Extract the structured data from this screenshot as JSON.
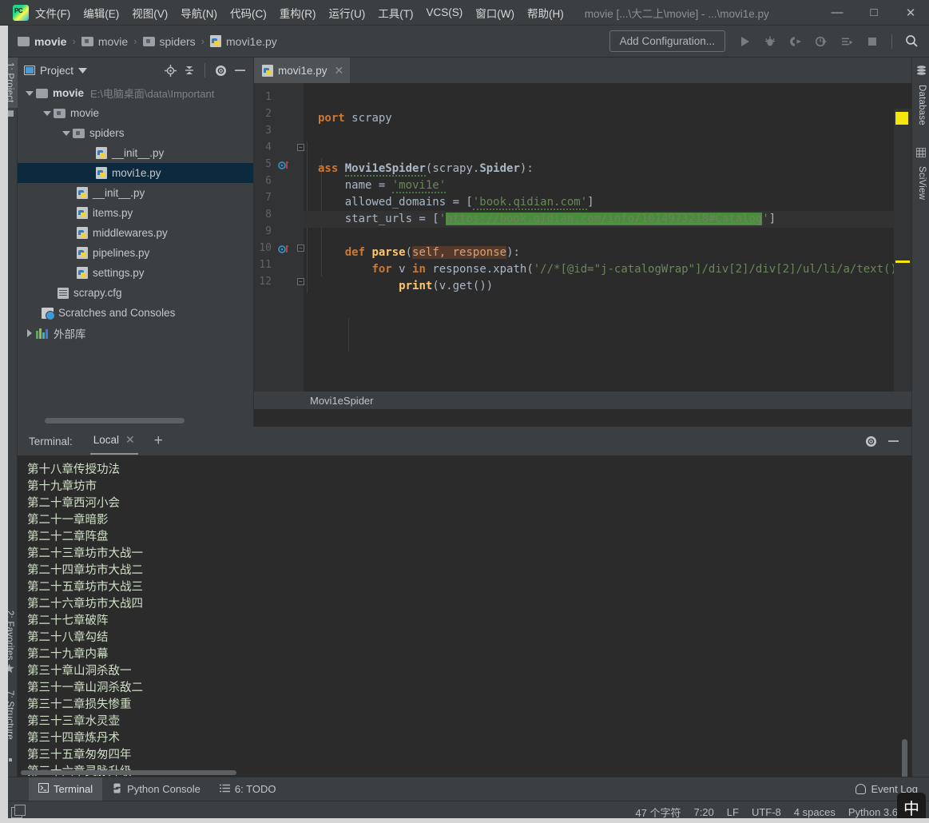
{
  "window": {
    "title": "movie [...\\大二上\\movie] - ...\\movi1e.py",
    "minimize": "—",
    "maximize": "□",
    "close": "✕"
  },
  "menubar": {
    "logo_icon": "pycharm-logo-icon",
    "items": [
      {
        "label": "文件(F)",
        "name": "menu-file"
      },
      {
        "label": "编辑(E)",
        "name": "menu-edit"
      },
      {
        "label": "视图(V)",
        "name": "menu-view"
      },
      {
        "label": "导航(N)",
        "name": "menu-navigate"
      },
      {
        "label": "代码(C)",
        "name": "menu-code"
      },
      {
        "label": "重构(R)",
        "name": "menu-refactor"
      },
      {
        "label": "运行(U)",
        "name": "menu-run"
      },
      {
        "label": "工具(T)",
        "name": "menu-tools"
      },
      {
        "label": "VCS(S)",
        "name": "menu-vcs"
      },
      {
        "label": "窗口(W)",
        "name": "menu-window"
      },
      {
        "label": "帮助(H)",
        "name": "menu-help"
      }
    ]
  },
  "toolbar": {
    "breadcrumbs": [
      {
        "label": "movie",
        "icon": "folder-icon"
      },
      {
        "label": "movie",
        "icon": "folder-icon"
      },
      {
        "label": "spiders",
        "icon": "folder-icon"
      },
      {
        "label": "movi1e.py",
        "icon": "python-file-icon"
      }
    ],
    "separator": "›",
    "add_configuration": "Add Configuration...",
    "icons": [
      "run-icon",
      "debug-icon",
      "run-coverage-icon",
      "profile-icon",
      "run-with-console-icon",
      "stop-icon",
      "search-everywhere-icon"
    ]
  },
  "left_strip": {
    "tabs": [
      {
        "label": "1: Project",
        "name": "tool-window-project",
        "active": true
      },
      {
        "label": "2: Favorites",
        "name": "tool-window-favorites",
        "active": false
      },
      {
        "label": "7: Structure",
        "name": "tool-window-structure",
        "active": false
      }
    ]
  },
  "right_strip": {
    "tabs": [
      {
        "label": "Database",
        "name": "tool-window-database"
      },
      {
        "label": "SciView",
        "name": "tool-window-sciview"
      }
    ]
  },
  "project_panel": {
    "title": "Project",
    "header_icons": [
      "locate-icon",
      "collapse-all-icon",
      "settings-gear-icon",
      "hide-icon"
    ],
    "tree": [
      {
        "label": "movie",
        "path": "E:\\电脑桌面\\data\\Important",
        "indent": 0,
        "arrow": "down",
        "icon": "folder-icon",
        "bold": true,
        "selected": false
      },
      {
        "label": "movie",
        "path": "",
        "indent": 1,
        "arrow": "down",
        "icon": "folder-inner-icon",
        "bold": false,
        "selected": false
      },
      {
        "label": "spiders",
        "path": "",
        "indent": 2,
        "arrow": "down",
        "icon": "folder-inner-icon",
        "bold": false,
        "selected": false
      },
      {
        "label": "__init__.py",
        "path": "",
        "indent": 3,
        "arrow": "none",
        "icon": "python-file-icon",
        "bold": false,
        "selected": false
      },
      {
        "label": "movi1e.py",
        "path": "",
        "indent": 3,
        "arrow": "none",
        "icon": "python-file-icon",
        "bold": false,
        "selected": true
      },
      {
        "label": "__init__.py",
        "path": "",
        "indent": 2,
        "arrow": "none",
        "icon": "python-file-icon",
        "bold": false,
        "selected": false
      },
      {
        "label": "items.py",
        "path": "",
        "indent": 2,
        "arrow": "none",
        "icon": "python-file-icon",
        "bold": false,
        "selected": false
      },
      {
        "label": "middlewares.py",
        "path": "",
        "indent": 2,
        "arrow": "none",
        "icon": "python-file-icon",
        "bold": false,
        "selected": false
      },
      {
        "label": "pipelines.py",
        "path": "",
        "indent": 2,
        "arrow": "none",
        "icon": "python-file-icon",
        "bold": false,
        "selected": false
      },
      {
        "label": "settings.py",
        "path": "",
        "indent": 2,
        "arrow": "none",
        "icon": "python-file-icon",
        "bold": false,
        "selected": false
      },
      {
        "label": "scrapy.cfg",
        "path": "",
        "indent": 1,
        "arrow": "none",
        "icon": "config-file-icon",
        "bold": false,
        "selected": false
      },
      {
        "label": "Scratches and Consoles",
        "path": "",
        "indent": 1,
        "arrow": "none",
        "icon": "scratches-icon",
        "bold": false,
        "selected": false
      },
      {
        "label": "外部库",
        "path": "",
        "indent": 0,
        "arrow": "right",
        "icon": "external-libraries-icon",
        "bold": false,
        "selected": false
      }
    ]
  },
  "editor": {
    "tab": {
      "label": "movi1e.py",
      "icon": "python-file-icon",
      "close": "✕"
    },
    "breadcrumb": "Movi1eSpider",
    "line_numbers": [
      "1",
      "2",
      "3",
      "4",
      "5",
      "6",
      "7",
      "8",
      "9",
      "10",
      "11",
      "12"
    ],
    "lines": [
      {
        "n": 1,
        "text": "port scrapy"
      },
      {
        "n": 2,
        "text": ""
      },
      {
        "n": 3,
        "text": ""
      },
      {
        "n": 4,
        "text": "ass Movi1eSpider(scrapy.Spider):"
      },
      {
        "n": 5,
        "text": "    name = 'movi1e'"
      },
      {
        "n": 6,
        "text": "    allowed_domains = ['book.qidian.com']"
      },
      {
        "n": 7,
        "text": "    start_urls = ['https://book.qidian.com/info/1014973218#Catalog']"
      },
      {
        "n": 8,
        "text": ""
      },
      {
        "n": 9,
        "text": "    def parse(self, response):"
      },
      {
        "n": 10,
        "text": "        for v in response.xpath('//*[@id=\"j-catalogWrap\"]/div[2]/div[2]/ul/li/a/text()'):"
      },
      {
        "n": 11,
        "text": "            print(v.get())"
      },
      {
        "n": 12,
        "text": ""
      }
    ],
    "highlighted_url": "https://book.qidian.com/info/1014973218#Catalog",
    "caret_line": 7,
    "gutter_run_marks": [
      5,
      9
    ],
    "warning_color": "#f5e70b"
  },
  "terminal": {
    "label": "Terminal:",
    "tab": "Local",
    "tab_close": "✕",
    "new_tab": "+",
    "header_icons": [
      "settings-gear-icon",
      "hide-icon"
    ],
    "output": [
      "第十八章传授功法",
      "第十九章坊市",
      "第二十章西河小会",
      "第二十一章暗影",
      "第二十二章阵盘",
      "第二十三章坊市大战一",
      "第二十四章坊市大战二",
      "第二十五章坊市大战三",
      "第二十六章坊市大战四",
      "第二十七章破阵",
      "第二十八章勾结",
      "第二十九章内幕",
      "第三十章山洞杀敌一",
      "第三十一章山洞杀敌二",
      "第三十二章损失惨重",
      "第三十三章水灵壶",
      "第三十四章炼丹术",
      "第三十五章匆匆四年",
      "第三十六章灵脉升级"
    ]
  },
  "bottom_tabs": {
    "tabs": [
      {
        "label": "Terminal",
        "icon": "terminal-icon",
        "active": true,
        "name": "bottom-tab-terminal"
      },
      {
        "label": "Python Console",
        "icon": "python-icon",
        "active": false,
        "name": "bottom-tab-python-console"
      },
      {
        "label": "6: TODO",
        "icon": "todo-icon",
        "active": false,
        "name": "bottom-tab-todo"
      }
    ],
    "event_log": "Event Log",
    "event_log_icon": "bell-icon"
  },
  "statusbar": {
    "stack_icon": "stack-icon",
    "char_count": "47 个字符",
    "caret_position": "7:20",
    "line_separator": "LF",
    "encoding": "UTF-8",
    "indent": "4 spaces",
    "interpreter": "Python 3.6",
    "lock_icon": "lock-icon",
    "ime_badge": "中"
  },
  "colors": {
    "panel_bg": "#3c3f41",
    "editor_bg": "#2b2b2b",
    "selection_blue": "#0d293e",
    "string_green": "#6a8759",
    "keyword_orange": "#cc7832",
    "function_yellow": "#ffc66d",
    "url_highlight": "#4a8b3e",
    "warning_yellow": "#f5e70b",
    "terminal_text": "#d0e0c8"
  }
}
